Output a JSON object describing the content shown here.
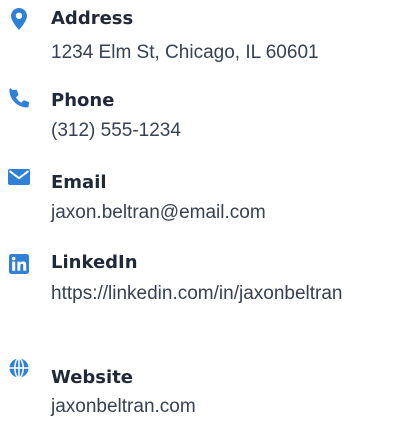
{
  "colors": {
    "accent": "#2f80d6",
    "label": "#1f2937",
    "value": "#374151"
  },
  "contacts": [
    {
      "icon": "map-pin-icon",
      "label": "Address",
      "value": "1234 Elm St, Chicago, IL 60601"
    },
    {
      "icon": "phone-icon",
      "label": "Phone",
      "value": "(312) 555-1234"
    },
    {
      "icon": "envelope-icon",
      "label": "Email",
      "value": "jaxon.beltran@email.com"
    },
    {
      "icon": "linkedin-icon",
      "label": "LinkedIn",
      "value": "https://linkedin.com/in/jaxonbeltran"
    },
    {
      "icon": "globe-icon",
      "label": "Website",
      "value": "jaxonbeltran.com"
    }
  ]
}
